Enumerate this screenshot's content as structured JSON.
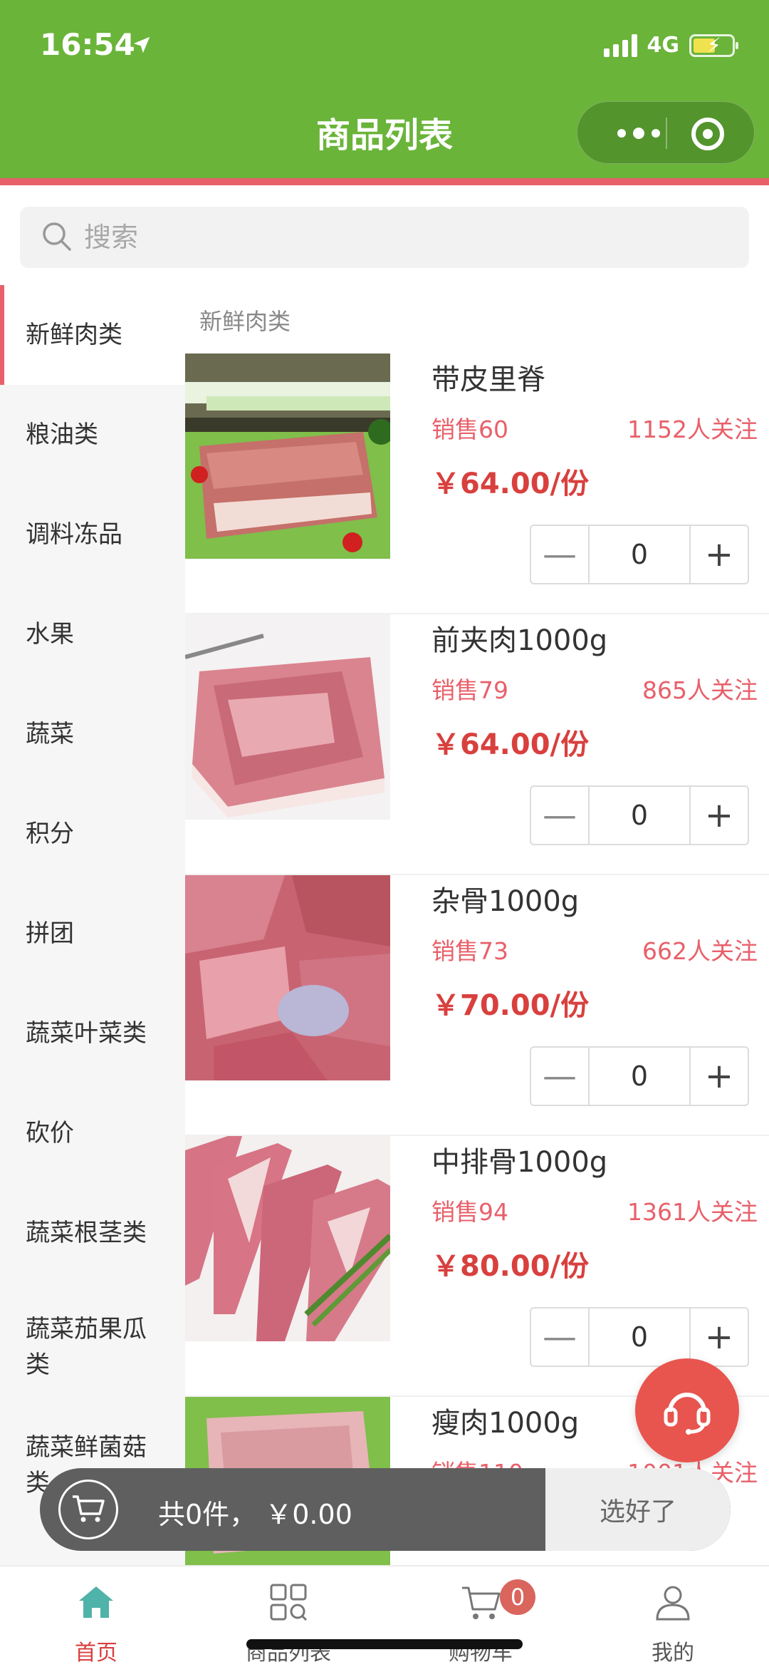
{
  "status_bar": {
    "time": "16:54",
    "network": "4G"
  },
  "nav": {
    "title": "商品列表"
  },
  "search": {
    "placeholder": "搜索"
  },
  "sidebar": {
    "items": [
      {
        "label": "新鲜肉类"
      },
      {
        "label": "粮油类"
      },
      {
        "label": "调料冻品"
      },
      {
        "label": "水果"
      },
      {
        "label": "蔬菜"
      },
      {
        "label": "积分"
      },
      {
        "label": "拼团"
      },
      {
        "label": "蔬菜叶菜类"
      },
      {
        "label": "砍价"
      },
      {
        "label": "蔬菜根茎类"
      },
      {
        "label": "蔬菜茄果瓜类"
      },
      {
        "label": "蔬菜鲜菌菇类"
      }
    ]
  },
  "content": {
    "section_title": "新鲜肉类",
    "products": [
      {
        "name": "带皮里脊",
        "sales": "销售60",
        "follow": "1152人关注",
        "price": "￥64.00/份",
        "qty": "0"
      },
      {
        "name": "前夹肉1000g",
        "sales": "销售79",
        "follow": "865人关注",
        "price": "￥64.00/份",
        "qty": "0"
      },
      {
        "name": "杂骨1000g",
        "sales": "销售73",
        "follow": "662人关注",
        "price": "￥70.00/份",
        "qty": "0"
      },
      {
        "name": "中排骨1000g",
        "sales": "销售94",
        "follow": "1361人关注",
        "price": "￥80.00/份",
        "qty": "0"
      },
      {
        "name": "瘦肉1000g",
        "sales": "销售110",
        "follow": "1001人关注",
        "price": "",
        "qty": ""
      }
    ]
  },
  "cart": {
    "summary": "共0件，  ￥0.00",
    "done_label": "选好了"
  },
  "tabbar": {
    "tabs": [
      {
        "label": "首页"
      },
      {
        "label": "商品列表"
      },
      {
        "label": "购物车",
        "badge": "0"
      },
      {
        "label": "我的"
      }
    ]
  },
  "colors": {
    "brand_green": "#6ab43a",
    "accent_red": "#e8606a",
    "price_red": "#d8403e"
  }
}
